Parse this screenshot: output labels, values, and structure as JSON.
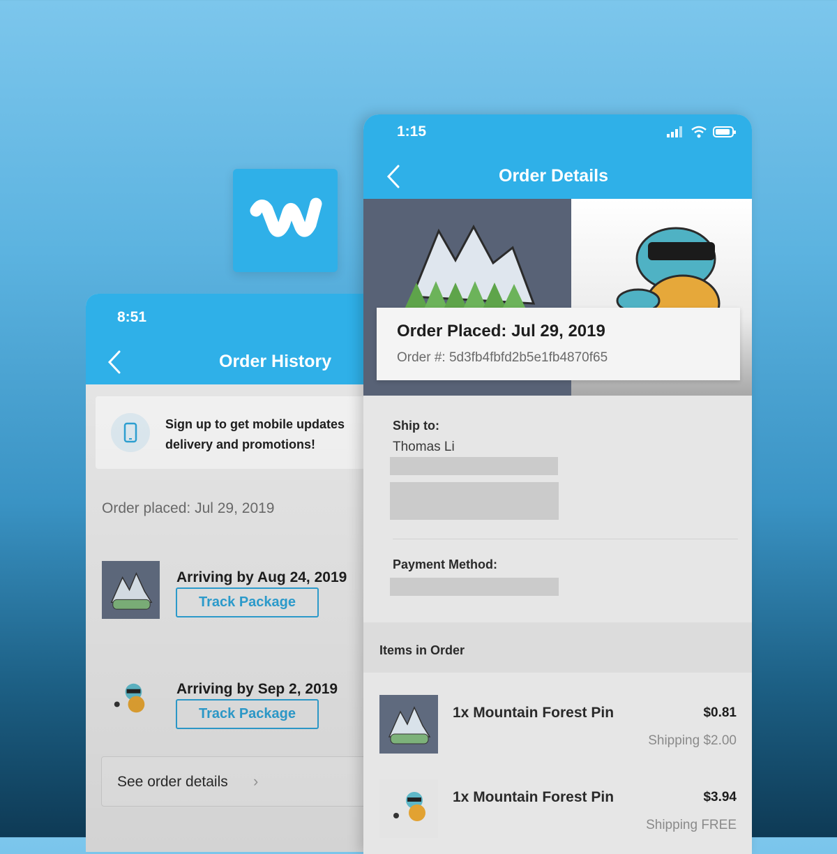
{
  "app_icon": {
    "name": "wish-logo-icon",
    "color": "#2fb0e8"
  },
  "order_history": {
    "status_time": "8:51",
    "title": "Order History",
    "promo_text": "Sign up to get mobile updates delivery and promotions!",
    "order_placed": "Order placed: Jul 29, 2019",
    "items": [
      {
        "arrival": "Arriving by Aug 24, 2019",
        "button": "Track Package",
        "thumb": "mountain-pin"
      },
      {
        "arrival": "Arriving by Sep 2, 2019",
        "button": "Track Package",
        "thumb": "turtle-pin"
      }
    ],
    "see_details": "See order details",
    "see_details_chevron": "›"
  },
  "order_details": {
    "status_time": "1:15",
    "title": "Order Details",
    "order_placed": "Order Placed: Jul 29, 2019",
    "order_number": "Order #: 5d3fb4fbfd2b5e1fb4870f65",
    "ship_to_label": "Ship to:",
    "ship_to_name": "Thomas Li",
    "payment_label": "Payment Method:",
    "items_label": "Items in Order",
    "items": [
      {
        "name": "1x Mountain Forest Pin",
        "price": "$0.81",
        "shipping": "Shipping $2.00",
        "thumb": "mountain-pin"
      },
      {
        "name": "1x Mountain Forest Pin",
        "price": "$3.94",
        "shipping": "Shipping FREE",
        "thumb": "turtle-pin"
      }
    ]
  },
  "colors": {
    "brand_blue": "#2fb0e8",
    "button_blue": "#2d9fd1"
  }
}
